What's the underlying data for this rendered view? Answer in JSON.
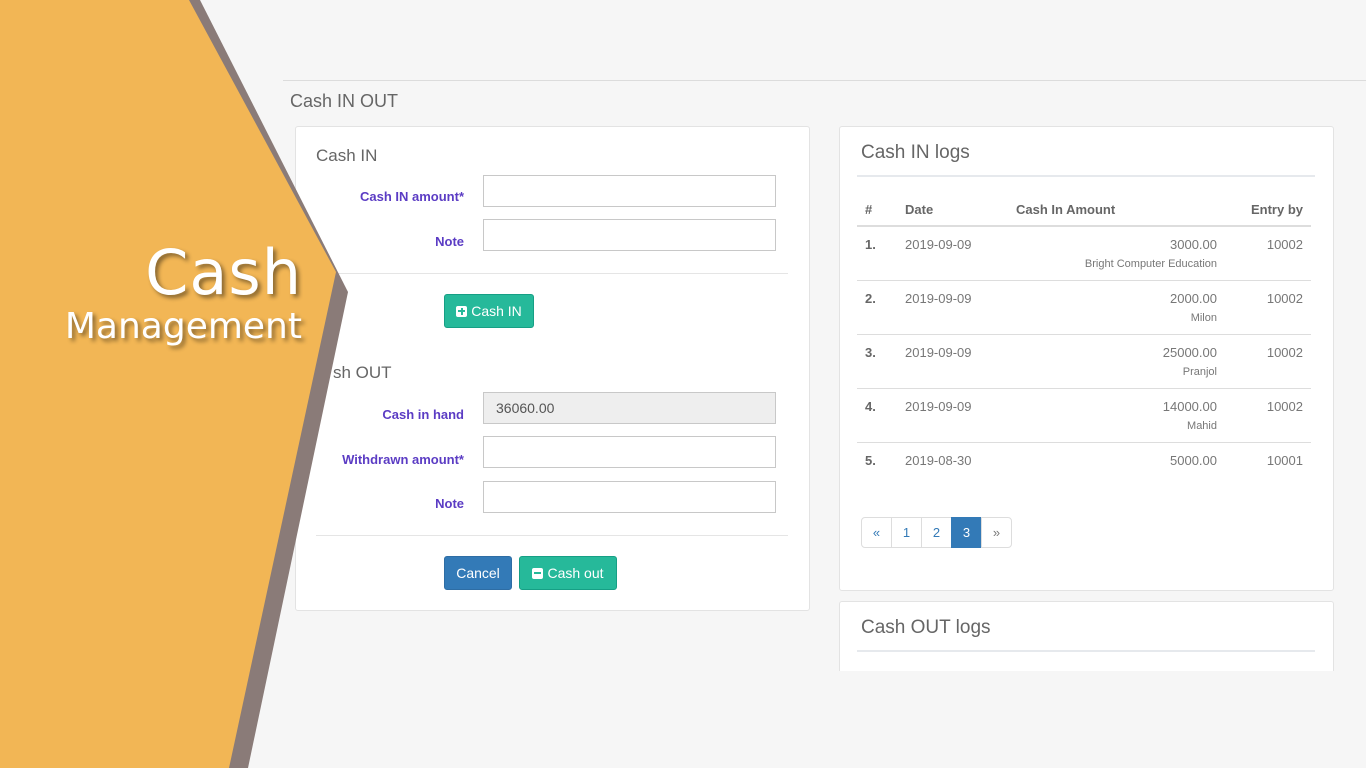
{
  "overlay": {
    "title_line1": "Cash",
    "title_line2": "Management",
    "accent_color": "#f2b655",
    "shadow_color": "#8a7b78"
  },
  "page": {
    "title": "Cash IN OUT"
  },
  "cash_in": {
    "section_title": "Cash IN",
    "amount_label": "Cash IN amount*",
    "amount_value": "",
    "note_label": "Note",
    "note_value": "",
    "submit_label": "Cash IN"
  },
  "cash_out": {
    "section_title": "sh OUT",
    "in_hand_label": "Cash in hand",
    "in_hand_value": "36060.00",
    "withdrawn_label": "Withdrawn amount*",
    "withdrawn_value": "",
    "note_label": "Note",
    "note_value": "",
    "cancel_label": "Cancel",
    "submit_label": "Cash out"
  },
  "in_logs": {
    "title": "Cash IN logs",
    "columns": [
      "#",
      "Date",
      "Cash In Amount",
      "Entry by"
    ],
    "rows": [
      {
        "num": "1.",
        "date": "2019-09-09",
        "amount": "3000.00",
        "note": "Bright Computer Education",
        "entry_by": "10002"
      },
      {
        "num": "2.",
        "date": "2019-09-09",
        "amount": "2000.00",
        "note": "Milon",
        "entry_by": "10002"
      },
      {
        "num": "3.",
        "date": "2019-09-09",
        "amount": "25000.00",
        "note": "Pranjol",
        "entry_by": "10002"
      },
      {
        "num": "4.",
        "date": "2019-09-09",
        "amount": "14000.00",
        "note": "Mahid",
        "entry_by": "10002"
      },
      {
        "num": "5.",
        "date": "2019-08-30",
        "amount": "5000.00",
        "note": "",
        "entry_by": "10001"
      }
    ],
    "pagination": {
      "prev": "«",
      "pages": [
        "1",
        "2",
        "3"
      ],
      "active_page": "3",
      "next": "»"
    }
  },
  "out_logs": {
    "title": "Cash OUT logs"
  }
}
